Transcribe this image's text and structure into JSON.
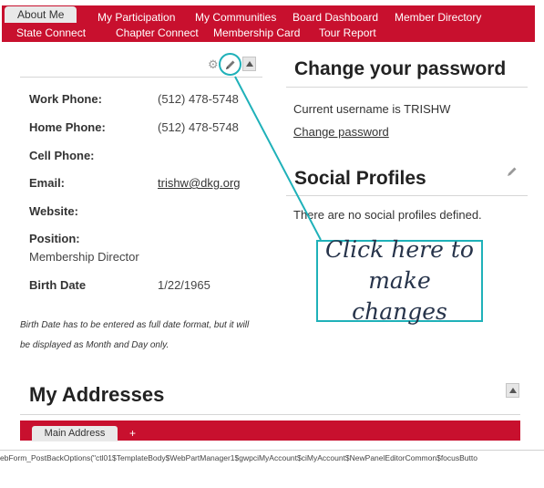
{
  "nav": {
    "tabs": [
      {
        "label": "About Me"
      },
      {
        "label": "My Participation"
      },
      {
        "label": "My Communities"
      },
      {
        "label": "Board Dashboard"
      },
      {
        "label": "Member Directory"
      },
      {
        "label": "State Connect"
      },
      {
        "label": "Chapter Connect"
      },
      {
        "label": "Membership Card"
      },
      {
        "label": "Tour Report"
      }
    ]
  },
  "contact": {
    "work_phone_label": "Work Phone:",
    "work_phone": "(512) 478-5748",
    "home_phone_label": "Home Phone:",
    "home_phone": "(512) 478-5748",
    "cell_phone_label": "Cell Phone:",
    "email_label": "Email:",
    "email": "trishw@dkg.org",
    "website_label": "Website:",
    "position_label": "Position:",
    "position": "Membership Director",
    "birth_date_label": "Birth Date",
    "birth_date": "1/22/1965",
    "note_line1": "Birth Date has to be entered as full date format, but it will",
    "note_line2": "be displayed as Month and Day only."
  },
  "password": {
    "title": "Change your password",
    "current_username": "Current username is  TRISHW",
    "link": "Change password"
  },
  "social": {
    "title": "Social Profiles",
    "empty": "There are no social profiles defined."
  },
  "callout": {
    "line1": "Click here to",
    "line2": "make changes",
    "accent": "#1fb1b9"
  },
  "addresses": {
    "title": "My Addresses",
    "tab": "Main Address",
    "add": "+"
  },
  "status": {
    "text": "ebForm_PostBackOptions(\"ctl01$TemplateBody$WebPartManager1$gwpciMyAccount$ciMyAccount$NewPanelEditorCommon$focusButto"
  },
  "colors": {
    "brand_red": "#c8102e",
    "tab_gray": "#e9e9e9"
  }
}
